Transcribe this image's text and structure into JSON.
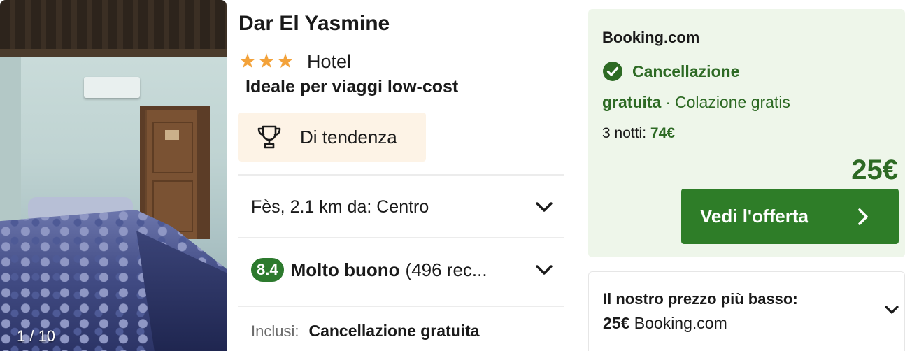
{
  "photo": {
    "counter": "1 / 10"
  },
  "hotel": {
    "name": "Dar El Yasmine",
    "star_count": 3,
    "type": "Hotel",
    "tagline": "Ideale per viaggi low-cost",
    "trend_label": "Di tendenza"
  },
  "location": {
    "text": "Fès, 2.1 km da: Centro"
  },
  "rating": {
    "score": "8.4",
    "word": "Molto buono",
    "count": "(496 rec..."
  },
  "included": {
    "label": "Inclusi:",
    "value": "Cancellazione gratuita"
  },
  "offer": {
    "provider": "Booking.com",
    "cancel_line1": "Cancellazione",
    "cancel_line2": "gratuita",
    "separator": "·",
    "breakfast": "Colazione gratis",
    "nights_label": "3 notti:",
    "nights_price": "74€",
    "price": "25€",
    "cta_label": "Vedi l'offerta"
  },
  "lowest": {
    "title": "Il nostro prezzo più basso:",
    "price": "25€",
    "provider": "Booking.com"
  },
  "colors": {
    "accent_green": "#2d7a2e",
    "star_orange": "#f3a23a",
    "offer_background": "#eef6ea",
    "trend_background": "#fdf3e6"
  },
  "icons": {
    "trophy": "trophy-icon",
    "check": "check-circle-icon",
    "chevron": "chevron-down-icon",
    "cta_chevron": "chevron-right-icon"
  }
}
